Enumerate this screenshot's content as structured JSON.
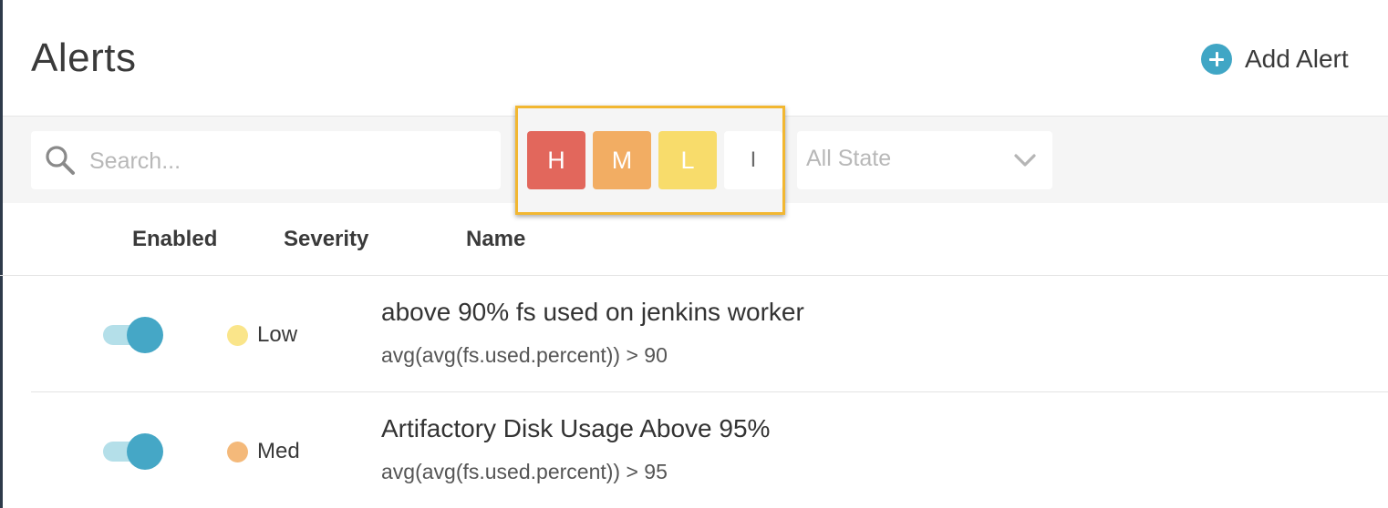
{
  "header": {
    "title": "Alerts",
    "add_alert_label": "Add Alert"
  },
  "filters": {
    "search": {
      "placeholder": "Search...",
      "value": ""
    },
    "severity_buttons": [
      {
        "label": "H",
        "color": "#e2675c"
      },
      {
        "label": "M",
        "color": "#f2ad63"
      },
      {
        "label": "L",
        "color": "#f8dc6b"
      },
      {
        "label": "I",
        "color": "#ffffff"
      }
    ],
    "highlight_color": "#f2b731",
    "state_select": {
      "value": "All State",
      "icon": "chevron-down-icon"
    }
  },
  "table": {
    "columns": [
      "Enabled",
      "Severity",
      "Name"
    ],
    "rows": [
      {
        "enabled": true,
        "severity": "Low",
        "severity_color": "#fae58a",
        "name": "above 90% fs used on jenkins worker",
        "query": "avg(avg(fs.used.percent)) > 90"
      },
      {
        "enabled": true,
        "severity": "Med",
        "severity_color": "#f4b97a",
        "name": "Artifactory Disk Usage Above 95%",
        "query": "avg(avg(fs.used.percent)) > 95"
      }
    ]
  },
  "colors": {
    "accent": "#40a6c5",
    "toggle_track": "#b4dfe9",
    "toggle_knob": "#45a7c6"
  }
}
